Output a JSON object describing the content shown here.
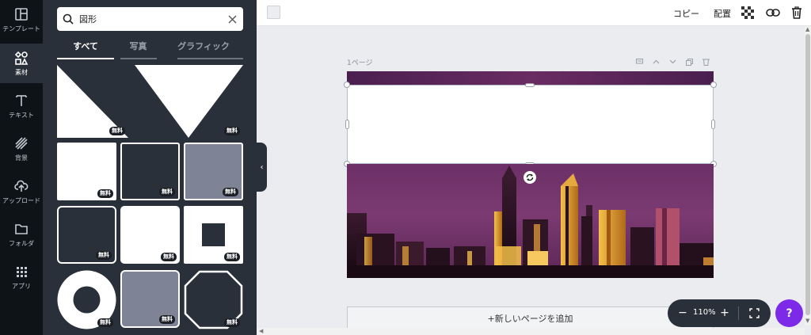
{
  "rail": {
    "items": [
      {
        "label": "テンプレート",
        "icon": "layout-icon"
      },
      {
        "label": "素材",
        "icon": "shapes-icon"
      },
      {
        "label": "テキスト",
        "icon": "text-icon"
      },
      {
        "label": "背景",
        "icon": "background-icon"
      },
      {
        "label": "アップロード",
        "icon": "upload-icon"
      },
      {
        "label": "フォルダ",
        "icon": "folder-icon"
      },
      {
        "label": "アプリ",
        "icon": "apps-icon"
      }
    ],
    "active_index": 1
  },
  "panel": {
    "search_value": "図形",
    "tabs": [
      "すべて",
      "写真",
      "グラフィック"
    ],
    "active_tab": 0,
    "badge_label": "無料"
  },
  "toolbar": {
    "copy_label": "コピー",
    "arrange_label": "配置"
  },
  "canvas": {
    "page_label": "1ページ",
    "add_page_label": "+新しいページを追加"
  },
  "zoom": {
    "value": "110%",
    "minus": "−",
    "plus": "+"
  },
  "help": {
    "label": "?"
  },
  "colors": {
    "rail_bg": "#0e1318",
    "panel_bg": "#293039",
    "accent": "#7d2ae8",
    "photo_purple": "#6d2f67"
  }
}
